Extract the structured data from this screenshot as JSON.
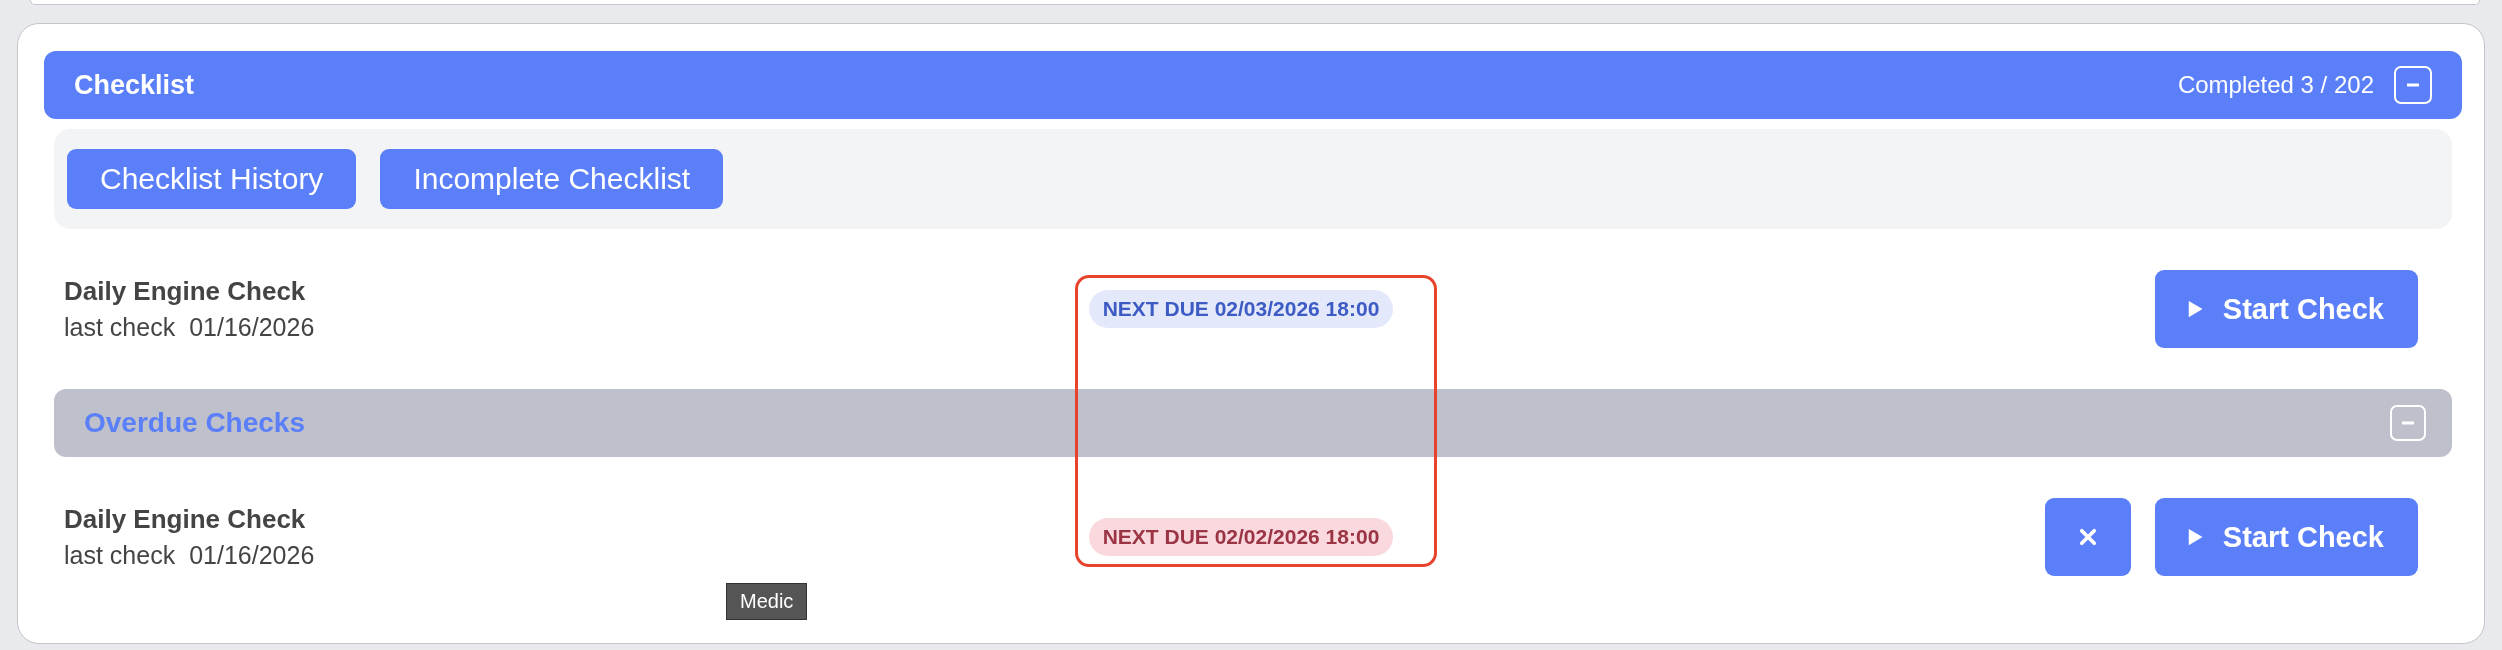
{
  "checklist": {
    "title": "Checklist",
    "completed": "Completed 3 / 202",
    "expanded": true,
    "toolbar": [
      {
        "label": "Checklist History"
      },
      {
        "label": "Incomplete Checklist"
      }
    ],
    "items": [
      {
        "name": "Daily Engine Check",
        "last_check_label": "last check",
        "last_check_date": "01/16/2026",
        "next_due": "NEXT DUE 02/03/2026 18:00",
        "kind": "upcoming",
        "dismissible": false,
        "start": "Start Check"
      }
    ]
  },
  "overdue": {
    "title": "Overdue Checks",
    "expanded": true,
    "items": [
      {
        "name": "Daily Engine Check",
        "last_check_label": "last check",
        "last_check_date": "01/16/2026",
        "next_due": "NEXT DUE 02/02/2026 18:00",
        "kind": "overdue",
        "dismissible": true,
        "start": "Start Check"
      }
    ]
  },
  "highlight_box": true,
  "tooltip": "Medic"
}
